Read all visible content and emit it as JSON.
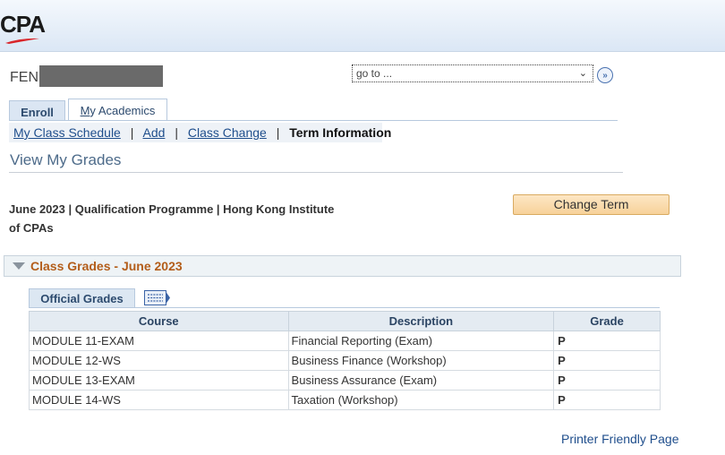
{
  "header": {
    "logo_text": "CPA"
  },
  "user": {
    "name_visible": "FEN"
  },
  "goto": {
    "value": "go to ..."
  },
  "tabs": [
    {
      "label": "Enroll"
    },
    {
      "label_first": "M",
      "label_rest": "y Academics"
    }
  ],
  "subnav": {
    "items": [
      {
        "first": "M",
        "rest": "y Class Schedule"
      },
      {
        "first": "A",
        "rest": "dd"
      },
      {
        "first": "C",
        "rest": "lass Change"
      }
    ],
    "current": "Term Information",
    "separator": "|"
  },
  "page": {
    "title": "View My Grades",
    "term_line1": "June 2023 | Qualification Programme | Hong Kong Institute",
    "term_line2": "of CPAs",
    "change_term": "Change Term"
  },
  "section": {
    "title": "Class Grades - June 2023"
  },
  "grades": {
    "tab_label": "Official Grades",
    "headers": {
      "course": "Course",
      "description": "Description",
      "grade": "Grade"
    },
    "rows": [
      {
        "course": "MODULE 11-EXAM",
        "description": "Financial Reporting (Exam)",
        "grade": "P"
      },
      {
        "course": "MODULE 12-WS",
        "description": "Business Finance (Workshop)",
        "grade": "P"
      },
      {
        "course": "MODULE 13-EXAM",
        "description": "Business Assurance (Exam)",
        "grade": "P"
      },
      {
        "course": "MODULE 14-WS",
        "description": "Taxation (Workshop)",
        "grade": "P"
      }
    ]
  },
  "footer": {
    "printer_link": "Printer Friendly Page"
  },
  "colors": {
    "section_title": "#b35d1a",
    "link": "#1f4e8c",
    "button": "#f7d29a",
    "banner": "#dbe7f5"
  },
  "icons": {
    "logo_swoosh": "red-swoosh",
    "goto": "double-chevron-right-icon",
    "grid_view": "grid-view-icon",
    "collapse": "triangle-down-icon"
  }
}
